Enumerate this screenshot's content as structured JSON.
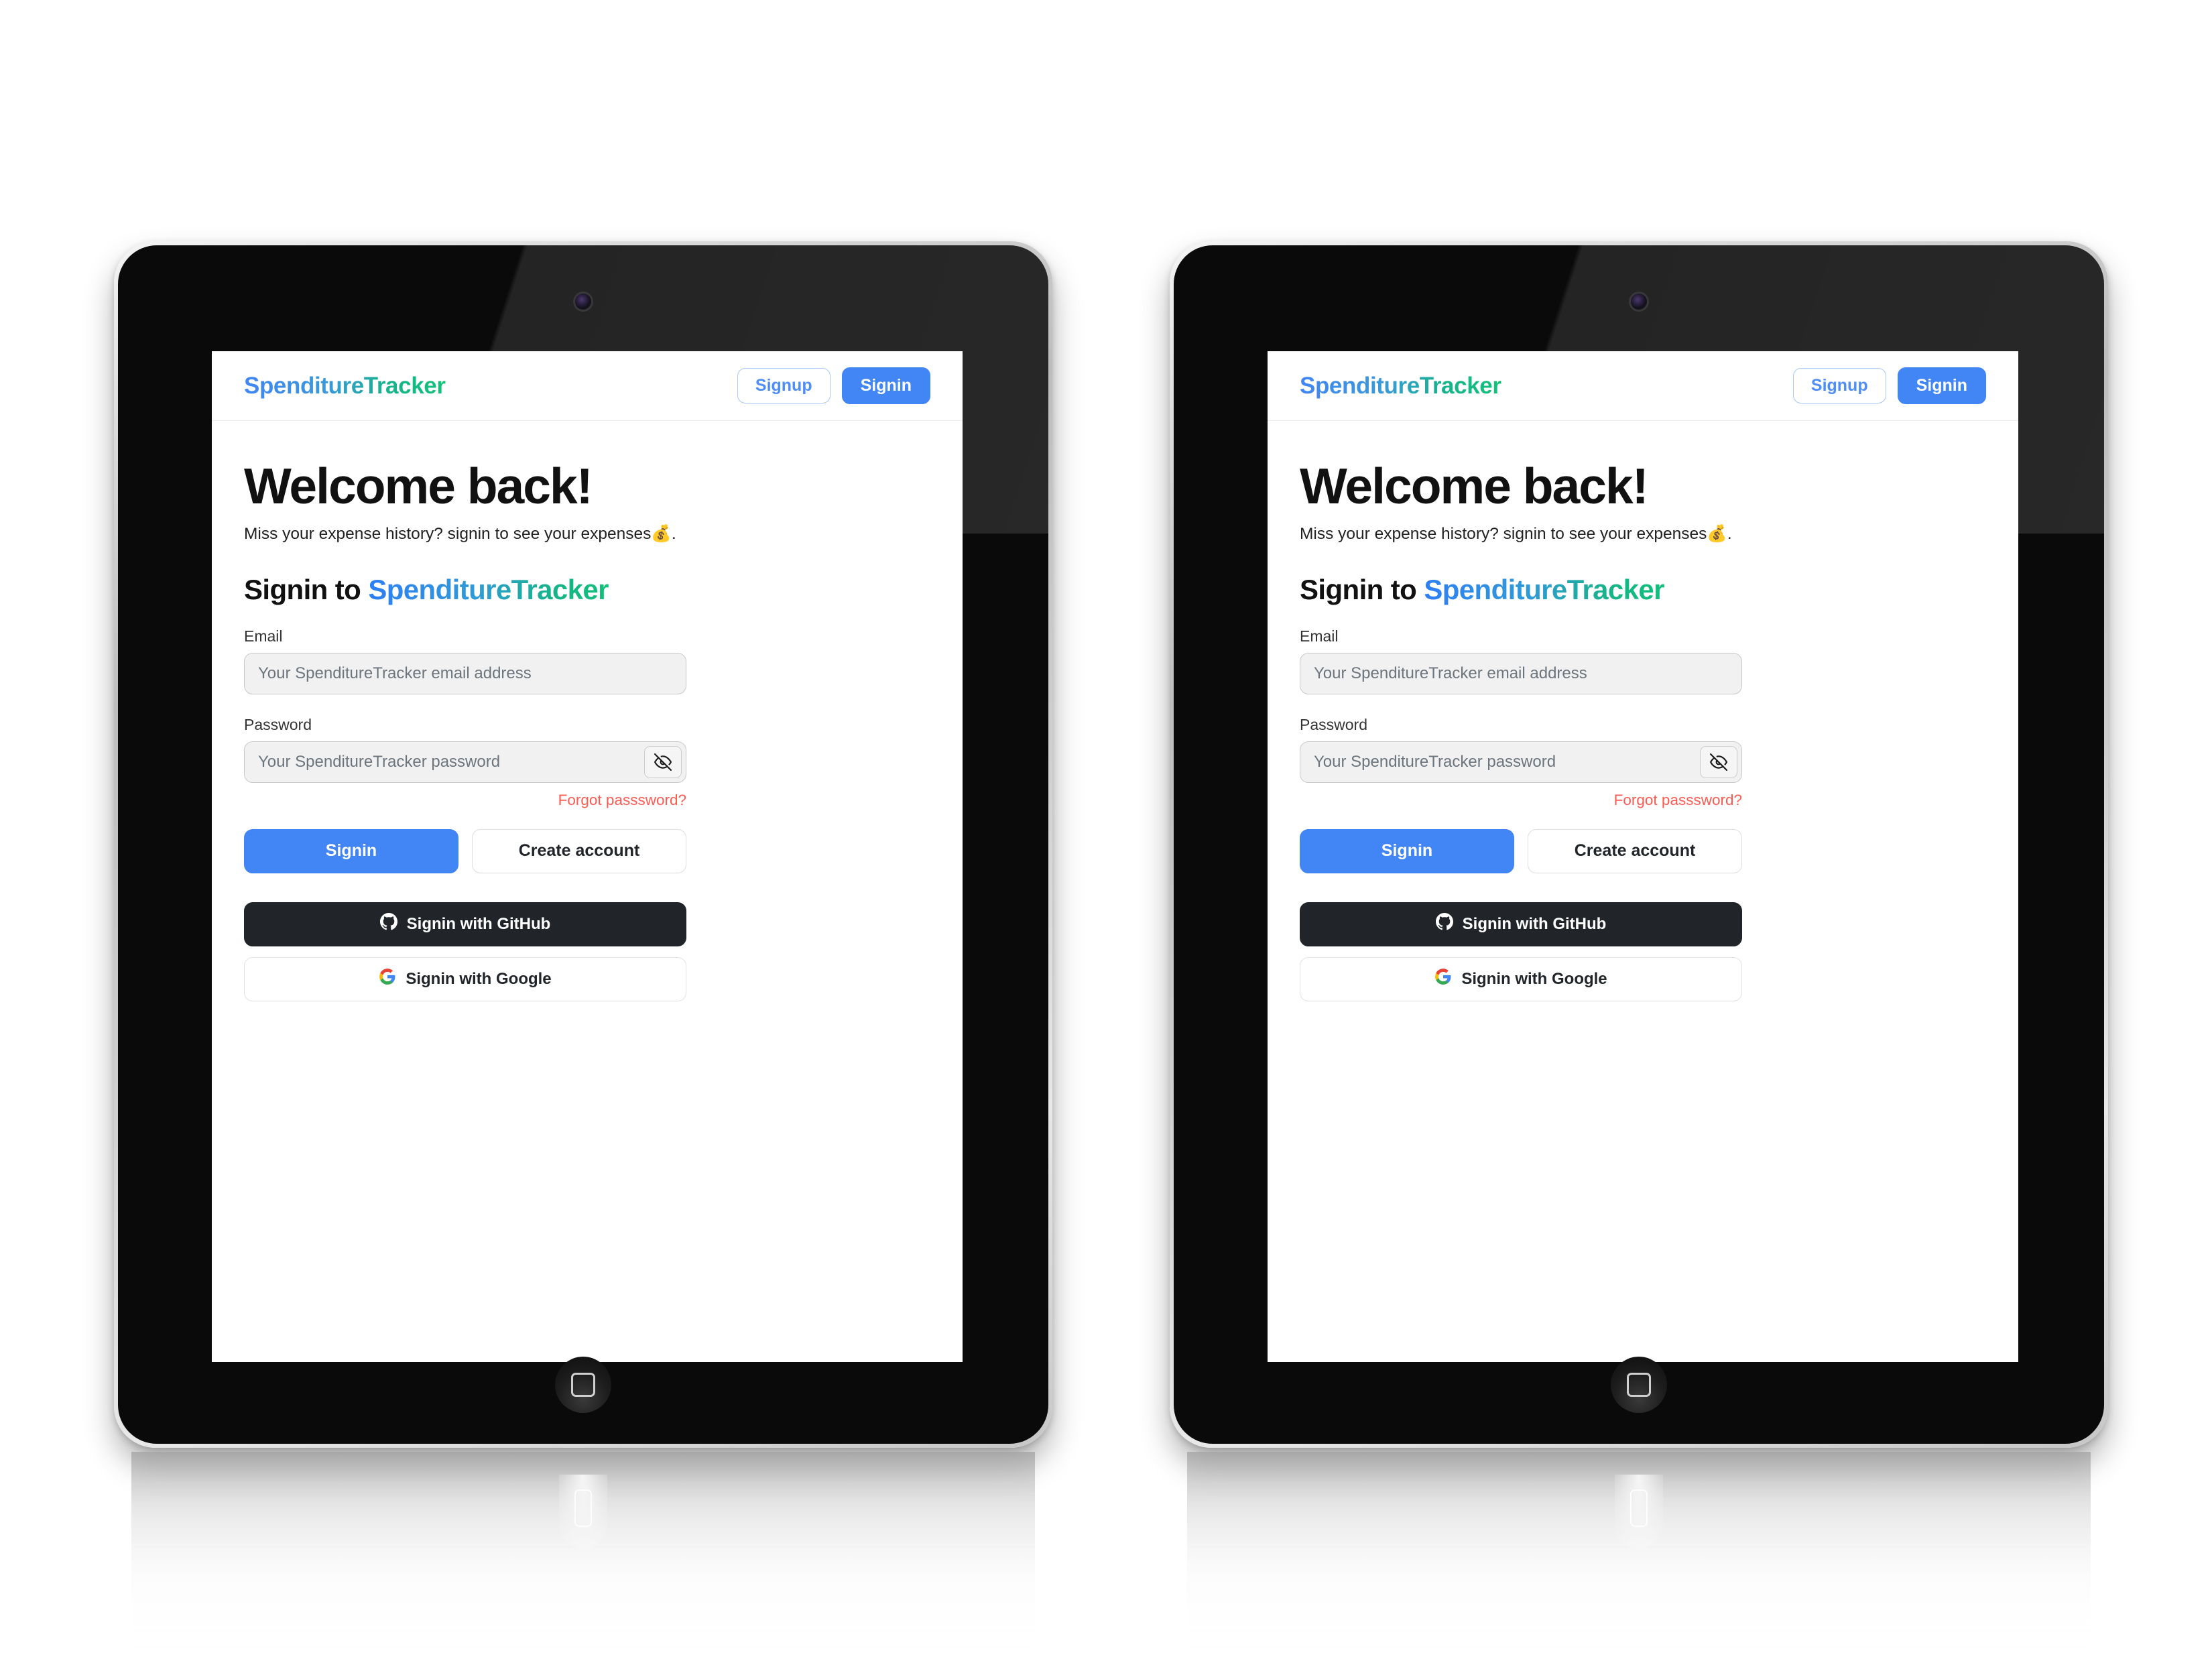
{
  "devices": [
    {
      "side": "left"
    },
    {
      "side": "right"
    }
  ],
  "app": {
    "brand": "SpenditureTracker",
    "nav": {
      "signup_label": "Signup",
      "signin_label": "Signin"
    },
    "hero": {
      "title": "Welcome back!",
      "subtitle": "Miss your expense history? signin to see your expenses💰."
    },
    "form": {
      "heading_prefix": "Signin to ",
      "heading_brand": "SpenditureTracker",
      "email_label": "Email",
      "email_placeholder": "Your SpenditureTracker email address",
      "email_value": "",
      "password_label": "Password",
      "password_placeholder": "Your SpenditureTracker password",
      "password_value": "",
      "password_toggle_icon": "eye-off-icon",
      "forgot_label": "Forgot passsword?",
      "submit_label": "Signin",
      "create_account_label": "Create account"
    },
    "social": {
      "github_label": "Signin with GitHub",
      "github_icon": "github-icon",
      "google_label": "Signin with Google",
      "google_icon": "google-icon"
    }
  },
  "colors": {
    "primary": "#4285f4",
    "brand_gradient_start": "#4285F4",
    "brand_gradient_end": "#12c27a",
    "danger": "#ff5a52",
    "github_dark": "#212529",
    "input_fill": "#f1f1f1"
  }
}
